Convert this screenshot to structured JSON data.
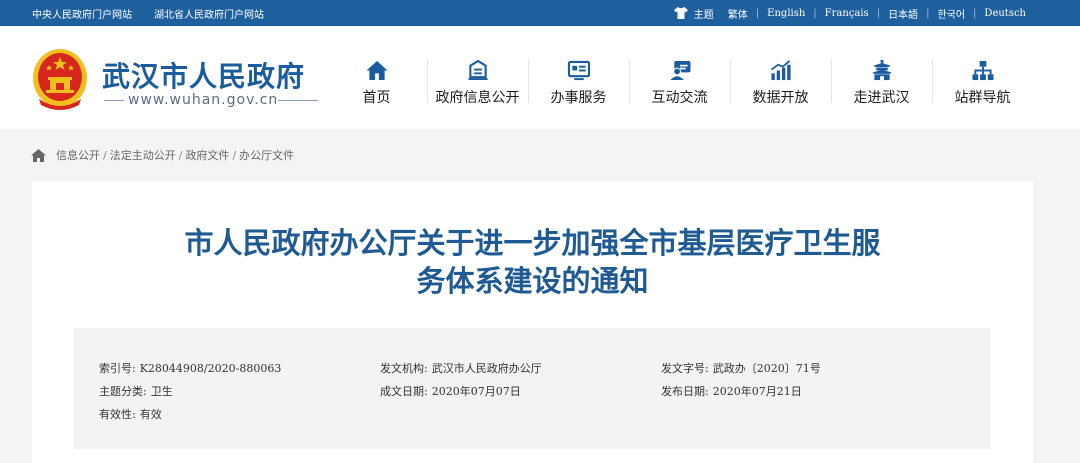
{
  "topbar": {
    "links": [
      "中央人民政府门户网站",
      "湖北省人民政府门户网站"
    ],
    "theme_label": "主题",
    "languages": [
      "繁体",
      "English",
      "Français",
      "日本語",
      "한국어",
      "Deutsch"
    ]
  },
  "header": {
    "site_title": "武汉市人民政府",
    "site_url": "www.wuhan.gov.cn"
  },
  "nav": [
    {
      "label": "首页",
      "icon": "home-icon"
    },
    {
      "label": "政府信息公开",
      "icon": "info-disclosure-icon"
    },
    {
      "label": "办事服务",
      "icon": "service-icon"
    },
    {
      "label": "互动交流",
      "icon": "interaction-icon"
    },
    {
      "label": "数据开放",
      "icon": "data-chart-icon"
    },
    {
      "label": "走进武汉",
      "icon": "landmark-icon"
    },
    {
      "label": "站群导航",
      "icon": "sitemap-icon"
    }
  ],
  "breadcrumb": [
    "信息公开",
    "法定主动公开",
    "政府文件",
    "办公厅文件"
  ],
  "article": {
    "title_line1": "市人民政府办公厅关于进一步加强全市基层医疗卫生服",
    "title_line2": "务体系建设的通知",
    "meta": {
      "index_label": "索引号:",
      "index_value": "K28044908/2020-880063",
      "issuer_label": "发文机构:",
      "issuer_value": "武汉市人民政府办公厅",
      "doc_no_label": "发文字号:",
      "doc_no_value": "武政办〔2020〕71号",
      "topic_label": "主题分类:",
      "topic_value": "卫生",
      "written_label": "成文日期:",
      "written_value": "2020年07月07日",
      "published_label": "发布日期:",
      "published_value": "2020年07月21日",
      "validity_label": "有效性:",
      "validity_value": "有效"
    }
  },
  "colors": {
    "topbar": "#1e5f9e",
    "brand_blue": "#1b5c9f",
    "title_blue": "#1f5a92",
    "emblem_red": "#d7261c",
    "emblem_gold": "#f2c01e"
  }
}
